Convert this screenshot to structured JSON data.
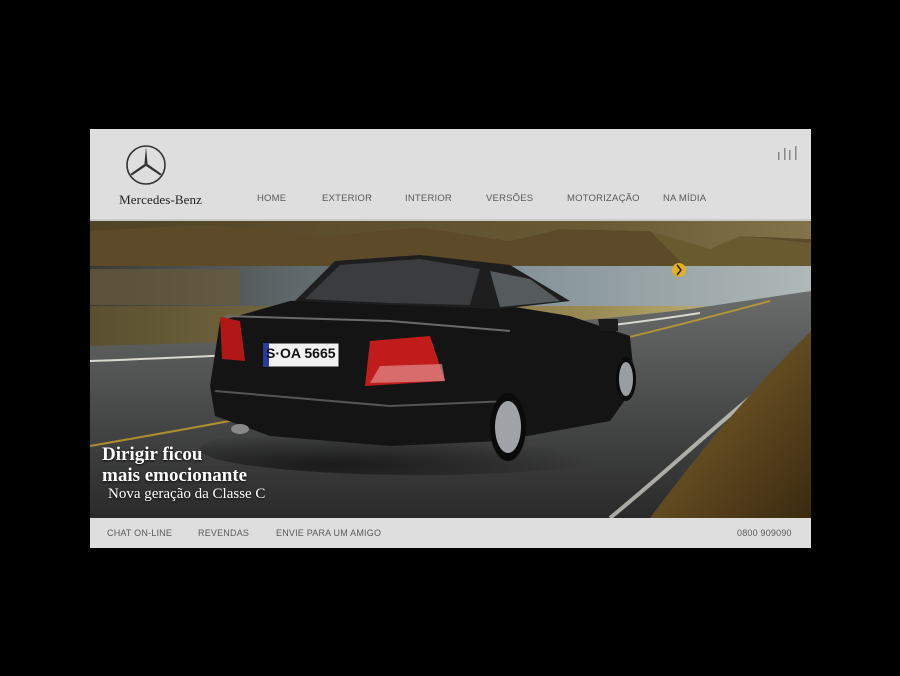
{
  "brand": {
    "name": "Mercedes-Benz"
  },
  "nav": {
    "items": [
      {
        "label": "HOME"
      },
      {
        "label": "EXTERIOR"
      },
      {
        "label": "INTERIOR"
      },
      {
        "label": "VERSÕES"
      },
      {
        "label": "MOTORIZAÇÃO"
      },
      {
        "label": "NA MÍDIA"
      }
    ]
  },
  "hero": {
    "headline_line1": "Dirigir ficou",
    "headline_line2": "mais emocionante",
    "subline": "Nova geração da Classe C",
    "plate": "S·OA 5665"
  },
  "footer": {
    "chat": "CHAT ON-LINE",
    "dealers": "REVENDAS",
    "send": "ENVIE PARA UM AMIGO",
    "phone": "0800 909090"
  },
  "colors": {
    "page_bg": "#000000",
    "header_bg": "#dedede",
    "nav_text": "#5a5a5a"
  },
  "icons": [
    "mercedes-star-icon",
    "signal-bars-icon"
  ]
}
